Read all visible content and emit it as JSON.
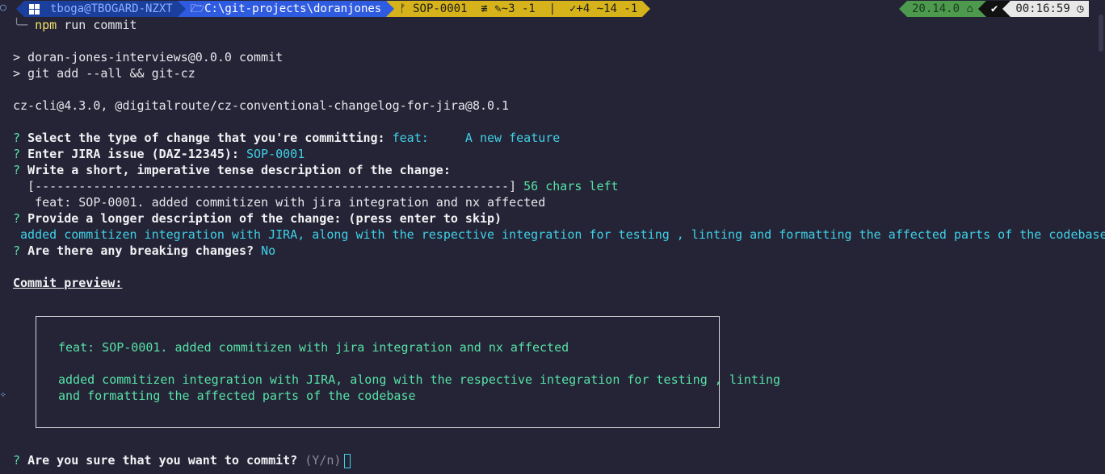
{
  "prompt": {
    "user": "tboga@TBOGARD-NZXT",
    "path": "C:\\git-projects\\doranjones",
    "branch_icon": "branch-icon",
    "branch": "SOP-0001",
    "status": "≢ ✎~3 -1  |  ✓+4 ~14 -1",
    "node_version": "20.14.0",
    "time": "00:16:59",
    "continuation": "╰─",
    "command_prefix": "npm",
    "command_rest": " run commit"
  },
  "output": {
    "script_line1": "> doran-jones-interviews@0.0.0 commit",
    "script_line2": "> git add --all && git-cz",
    "cz_version": "cz-cli@4.3.0, @digitalroute/cz-conventional-changelog-for-jira@8.0.1",
    "q_type": "Select the type of change that you're committing:",
    "a_type": "feat:     A new feature",
    "q_jira": "Enter JIRA issue (DAZ-12345):",
    "a_jira": "SOP-0001",
    "q_short": "Write a short, imperative tense description of the change:",
    "progress": "  [-----------------------------------------------------------------]",
    "chars_left": "56 chars left",
    "short_value": "   feat: SOP-0001. added commitizen with jira integration and nx affected",
    "q_long": "Provide a longer description of the change: (press enter to skip)",
    "a_long": " added commitizen integration with JIRA, along with the respective integration for testing , linting and formatting the affected parts of the codebase",
    "q_breaking": "Are there any breaking changes?",
    "a_breaking": "No",
    "preview_title": "Commit preview:",
    "preview_line1": "feat: SOP-0001. added commitizen with jira integration and nx affected",
    "preview_line2": "added commitizen integration with JIRA, along with the respective integration for testing , linting",
    "preview_line3": "and formatting the affected parts of the codebase",
    "q_confirm": "Are you sure that you want to commit?",
    "confirm_hint": "(Y/n)",
    "question_mark": "?"
  },
  "colors": {
    "background": "#252436",
    "cyan": "#3fd0e6",
    "green": "#56e2a6",
    "yellow": "#f1e36a"
  }
}
